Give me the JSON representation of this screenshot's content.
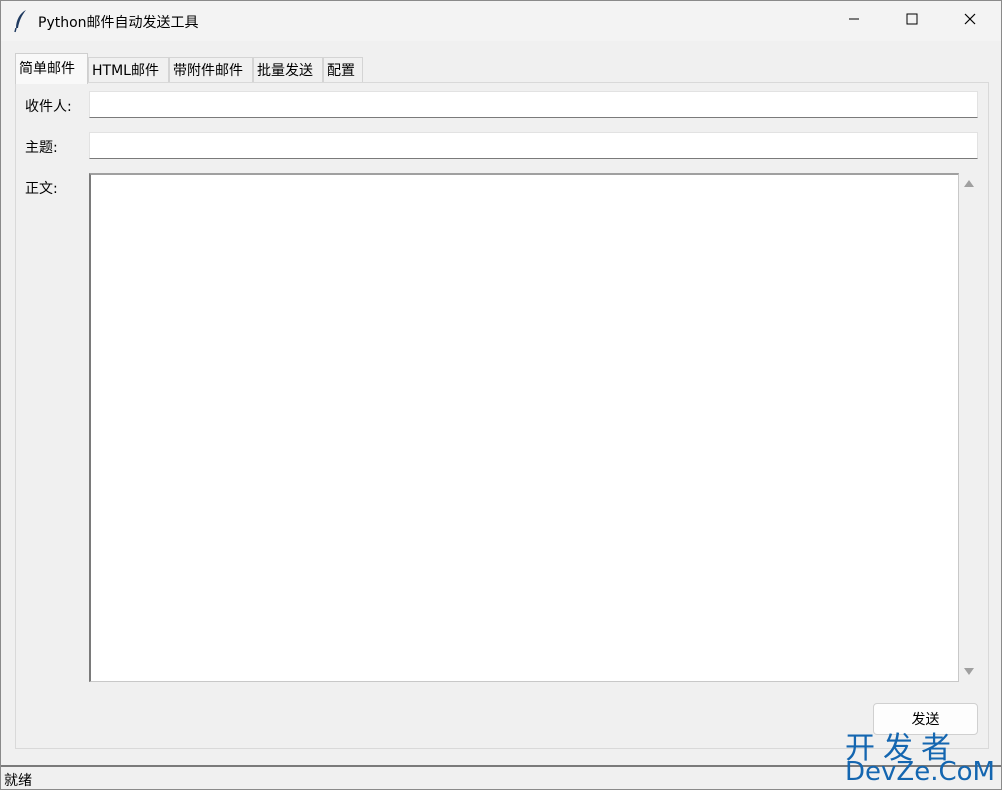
{
  "window": {
    "title": "Python邮件自动发送工具"
  },
  "tabs": [
    {
      "label": "简单邮件"
    },
    {
      "label": "HTML邮件"
    },
    {
      "label": "带附件邮件"
    },
    {
      "label": "批量发送"
    },
    {
      "label": "配置"
    }
  ],
  "form": {
    "recipient_label": "收件人:",
    "recipient_value": "",
    "subject_label": "主题:",
    "subject_value": "",
    "body_label": "正文:",
    "body_value": ""
  },
  "send_button": {
    "label": "发送"
  },
  "status": {
    "text": "就绪"
  },
  "watermark": {
    "line1": "开发者",
    "line2": "DevZe.CoM"
  },
  "colors": {
    "accent": "#1466b0",
    "background": "#f0f0f0"
  }
}
